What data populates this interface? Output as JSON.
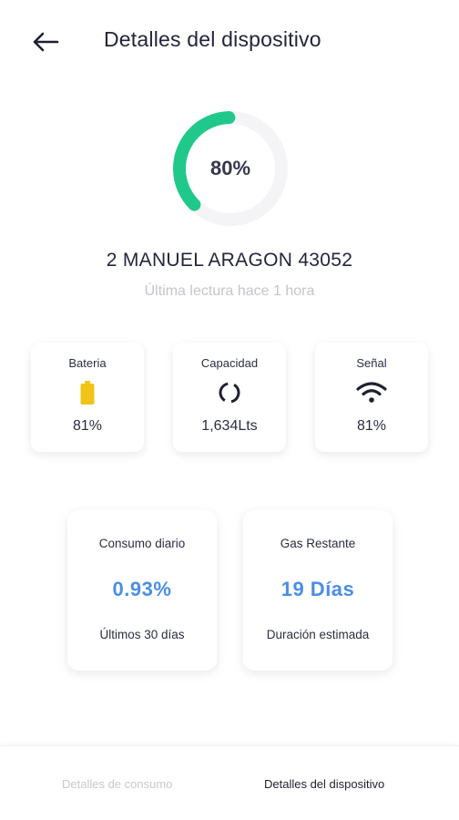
{
  "header": {
    "title": "Detalles del dispositivo",
    "back_icon": "arrow-left-icon"
  },
  "gauge": {
    "value_label": "80%",
    "fraction": 0.8,
    "color": "#20c98b",
    "track_color": "#f4f4f6"
  },
  "device": {
    "name": "2 MANUEL ARAGON 43052",
    "last_reading": "Última lectura hace 1 hora"
  },
  "stats": [
    {
      "label": "Bateria",
      "icon": "battery-icon",
      "value": "81%",
      "icon_color": "#f0c419"
    },
    {
      "label": "Capacidad",
      "icon": "loading-circle-icon",
      "value": "1,634Lts"
    },
    {
      "label": "Señal",
      "icon": "wifi-icon",
      "value": "81%"
    }
  ],
  "summary": [
    {
      "label": "Consumo diario",
      "value": "0.93%",
      "sub": "Últimos 30 días"
    },
    {
      "label": "Gas Restante",
      "value": "19 Días",
      "sub": "Duración estimada"
    }
  ],
  "bottom_nav": {
    "tabs": [
      {
        "label": "Detalles de consumo",
        "active": false
      },
      {
        "label": "Detalles del dispositivo",
        "active": true
      }
    ]
  },
  "colors": {
    "accent_green": "#20c98b",
    "accent_blue": "#4a8ee6"
  }
}
